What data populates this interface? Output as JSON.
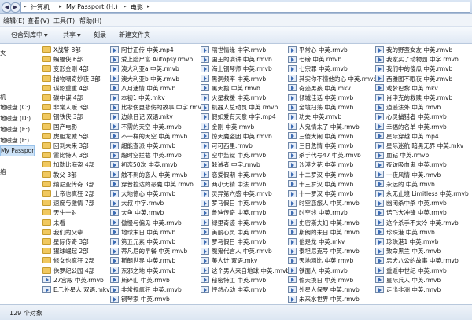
{
  "address": {
    "crumbs": [
      "计算机",
      "My Passport (H:)",
      "电影"
    ]
  },
  "menu": [
    "编辑(E)",
    "查看(V)",
    "工具(T)",
    "帮助(H)"
  ],
  "toolbar": {
    "include_label": "包含到库中",
    "share_label": "共享",
    "burn_label": "刻录",
    "new_folder_label": "新建文件夹"
  },
  "nav": [
    "夹",
    "机",
    "地磁盘 (C:)",
    "地磁盘 (D:)",
    "地磁盘 (E:)",
    "地磁盘 (F:)",
    "My Passport",
    "络"
  ],
  "files": {
    "col1": [
      "X战警 8部",
      "蝙蝠侠 6部",
      "变形金刚 4部",
      "捕物嘲奇妙夜 3部",
      "谍影重重 4部",
      "碟中谍 4部",
      "非常人贩 3部",
      "钢铁侠 3部",
      "国产电影",
      "虎胆龙威 5部",
      "回到未来 3部",
      "霍比特人 3部",
      "加勒比海盗 4部",
      "教父 3部",
      "纳尼亚传奇 3部",
      "上帝也疯狂 2部",
      "速度与激情 7部",
      "天生一对",
      "未看",
      "我们的父辈",
      "星际传奇 3部",
      "猩球崛起 2部",
      "修女也疯狂 2部",
      "侏罗纪公园 4部",
      "27宫殿 中英.rmvb",
      "E.T.外星人 双语.mkv"
    ],
    "col2": [
      "阿甘正传 中英.mp4",
      "爱上脸尸富 Autopsy.rmvb",
      "澳大利亚a 中英.rmvb",
      "澳大利亚b 中英.rmvb",
      "八月迷情 中英.rmvb",
      "本初1 中英.mkv",
      "比悲伤更悲伤的故事 中字.rmvb",
      "边缘日记 双语.mkv",
      "不需的天空 中英.rmvb",
      "不一样的天空 中英.rmvb",
      "超能查派 中英.rmvb",
      "超时空拦截 中英.rmvb",
      "初恋50次 中英.rmvb",
      "触不到的恋人 中英.rmvb",
      "穿普拉达的恶魔 中英.rmvb",
      "大地惊心 中英.rmvb",
      "大叔 中字.rmvb",
      "大鱼 中英.rmvb",
      "傲慢与偏见 中英.rmvb",
      "地球末日 中英.rmvb",
      "第五元素 中英.rmvb",
      "蒂凡尼的早餐 中英.rmvb",
      "斯朗世界 中英.rmvb",
      "东邪之地 中英.rmvb",
      "斯碎山 中英.rmvb",
      "非常规疯狂 中英.rmvb",
      "钢琴家 中英.rmvb"
    ],
    "col3": [
      "隔世情缘 中字.rmvb",
      "国王的演讲 中英.rmvb",
      "海上钢琴师 中英.rmvb",
      "黑洞频率 中英.rmvb",
      "黑天鹅 中英.rmvb",
      "火星救援 中英.rmvb",
      "机器人总动员 中英.rmvb",
      "假如爱有天意 中字.mp4",
      "金刚 中英.rmvb",
      "惊天魔盗团 中英.rmvb",
      "可可西里.rmvb",
      "空中监狱 中英.rmvb",
      "躲诫者 中字.rmvb",
      "恋爱假期 中英.rmvb",
      "两小无猜 中法.rmvb",
      "灵异第六感 中英.rmvb",
      "罗马假日 中英.rmvb",
      "鲁迪传奇 中英.rmvb",
      "绿里奇迹 中英.rmvb",
      "美丽心灵 中英.rmvb",
      "罗马假日 中英.rmvb",
      "魔鬼代言人 中英.rmvb",
      "美人计 双语.mkv",
      "这个男人来自地球 中英.rmvb",
      "秘密特工 中英.rmvb",
      "怦然心动 中英.rmvb"
    ],
    "col4": [
      "平常心 中英.rmvb",
      "七磅 中英.rmvb",
      "七宗罪 中英.rmvb",
      "其实你不懂他的心 中英.rmvb",
      "奇迹男孩 中英.mkv",
      "倾城佳话 中英.rmvb",
      "全境扫荡 中英.rmvb",
      "功夫 中英.rmvb",
      "人鬼情未了 中英.rmvb",
      "三傻大闹 中英.rmvb",
      "三日危情 中英.rmvb",
      "杀手代号47 中英.rmvb",
      "沙漠之花 中英.rmvb",
      "十二罗汉 中英.rmvb",
      "十三罗汉 中英.rmvb",
      "十一罗汉 中英.rmvb",
      "时空恋旅人 中英.rmvb",
      "时空线 中英.rmvb",
      "史密斯夫妇 中英.rmvb",
      "斯朗的未日 中英.rmvb",
      "他是龙 中英.mkv",
      "泰坦尼克号 中英.rmvb",
      "天地粗比 中英.rmvb",
      "铁面人 中英.rmvb",
      "偷天换日 中英.rmvb",
      "外星人保罗 中英.rmvb",
      "未来水世界 中英.rmvb"
    ],
    "col5": [
      "我的野蛮女友 中英.rmvb",
      "我家买了动物园 中字.rmvb",
      "我们中的傻瓜 中英.rmvb",
      "西雅图不眠夜 中英.rmvb",
      "戏梦巴黎 中英.mkv",
      "肖申克的救赎 中英.rmvb",
      "逍遥法外 中英.rmvb",
      "心灵捕猎者 中英.rmvb",
      "幸福的名单 中英.rmvb",
      "星际穿越 中英.mp4",
      "星际迷航 暗黑无界 中英.mkv",
      "血钻 中英.rmvb",
      "夜访吸血鬼 中英.rmvb",
      "一夜风情 中英.rmvb",
      "永远的 中英.rmvb",
      "永无止境 Limitless 中英.rmvb",
      "幽闭杀中杀 中英.rmvb",
      "诺飞大冲锋 中英.rmvb",
      "这个杀手不太冷 中英.rmvb",
      "珍珠港 中英.rmvb",
      "珍珠港1 中英.rmvb",
      "致命黑兰 中英.rmvb",
      "忠犬八公的故事 中英.rmvb",
      "重返中世纪 中英.rmvb",
      "星际兵人 中英.rmvb",
      "走出非洲 中英.rmvb"
    ]
  },
  "status": {
    "count": "129 个对象"
  }
}
